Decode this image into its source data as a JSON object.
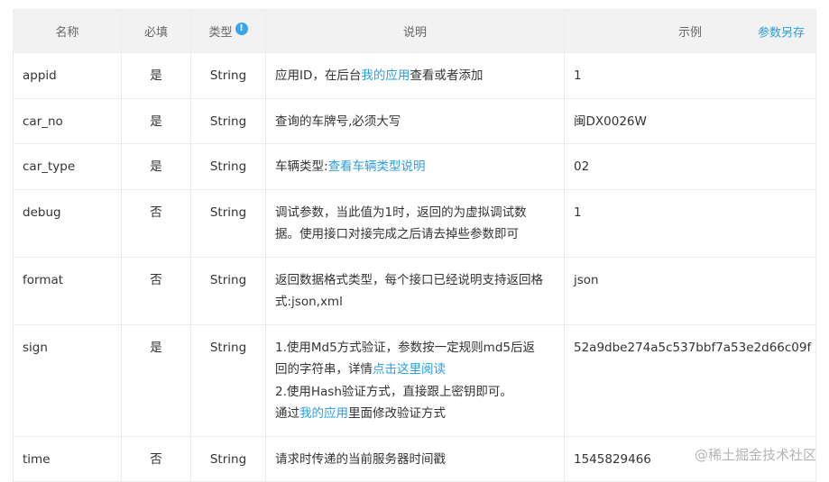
{
  "table": {
    "headers": {
      "name": "名称",
      "required": "必填",
      "type": "类型",
      "type_info_icon": "!",
      "description": "说明",
      "example": "示例",
      "save_as": "参数另存"
    },
    "rows": [
      {
        "name": "appid",
        "required": "是",
        "type": "String",
        "desc": {
          "a": "应用ID，在后台",
          "link": "我的应用",
          "b": "查看或者添加"
        },
        "example": "1"
      },
      {
        "name": "car_no",
        "required": "是",
        "type": "String",
        "desc": {
          "text": "查询的车牌号,必须大写"
        },
        "example": "闽DX0026W"
      },
      {
        "name": "car_type",
        "required": "是",
        "type": "String",
        "desc": {
          "a": "车辆类型:",
          "link": "查看车辆类型说明"
        },
        "example": "02"
      },
      {
        "name": "debug",
        "required": "否",
        "type": "String",
        "desc": {
          "line1": "调试参数，当此值为1时，返回的为虚拟调试数",
          "line2": "据。使用接口对接完成之后请去掉些参数即可"
        },
        "example": "1"
      },
      {
        "name": "format",
        "required": "否",
        "type": "String",
        "desc": {
          "line1": "返回数据格式类型，每个接口已经说明支持返回格",
          "line2": "式:json,xml"
        },
        "example": "json"
      },
      {
        "name": "sign",
        "required": "是",
        "type": "String",
        "desc": {
          "line1": "1.使用Md5方式验证，参数按一定规则md5后返",
          "line2a": "回的字符串，详情",
          "line2link": "点击这里阅读",
          "line3": "2.使用Hash验证方式，直接跟上密钥即可。",
          "line4a": "通过",
          "line4link": "我的应用",
          "line4b": "里面修改验证方式"
        },
        "example": "52a9dbe274a5c537bbf7a53e2d66c09f"
      },
      {
        "name": "time",
        "required": "否",
        "type": "String",
        "desc": {
          "text": "请求时传递的当前服务器时间戳"
        },
        "example": "1545829466"
      }
    ]
  },
  "watermark": {
    "text": "@稀土掘金技术社区"
  },
  "colors": {
    "link": "#2a9fe0",
    "header_bg": "#f2f2f2",
    "border": "#ececec"
  }
}
